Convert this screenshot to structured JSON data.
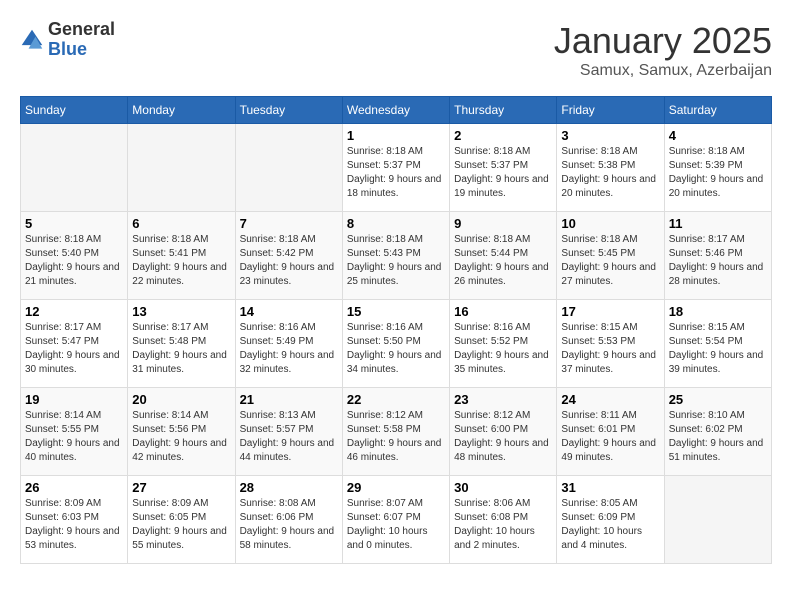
{
  "logo": {
    "general": "General",
    "blue": "Blue"
  },
  "title": "January 2025",
  "location": "Samux, Samux, Azerbaijan",
  "weekdays": [
    "Sunday",
    "Monday",
    "Tuesday",
    "Wednesday",
    "Thursday",
    "Friday",
    "Saturday"
  ],
  "weeks": [
    [
      {
        "day": "",
        "empty": true
      },
      {
        "day": "",
        "empty": true
      },
      {
        "day": "",
        "empty": true
      },
      {
        "day": "1",
        "sunrise": "8:18 AM",
        "sunset": "5:37 PM",
        "daylight": "9 hours and 18 minutes."
      },
      {
        "day": "2",
        "sunrise": "8:18 AM",
        "sunset": "5:37 PM",
        "daylight": "9 hours and 19 minutes."
      },
      {
        "day": "3",
        "sunrise": "8:18 AM",
        "sunset": "5:38 PM",
        "daylight": "9 hours and 20 minutes."
      },
      {
        "day": "4",
        "sunrise": "8:18 AM",
        "sunset": "5:39 PM",
        "daylight": "9 hours and 20 minutes."
      }
    ],
    [
      {
        "day": "5",
        "sunrise": "8:18 AM",
        "sunset": "5:40 PM",
        "daylight": "9 hours and 21 minutes."
      },
      {
        "day": "6",
        "sunrise": "8:18 AM",
        "sunset": "5:41 PM",
        "daylight": "9 hours and 22 minutes."
      },
      {
        "day": "7",
        "sunrise": "8:18 AM",
        "sunset": "5:42 PM",
        "daylight": "9 hours and 23 minutes."
      },
      {
        "day": "8",
        "sunrise": "8:18 AM",
        "sunset": "5:43 PM",
        "daylight": "9 hours and 25 minutes."
      },
      {
        "day": "9",
        "sunrise": "8:18 AM",
        "sunset": "5:44 PM",
        "daylight": "9 hours and 26 minutes."
      },
      {
        "day": "10",
        "sunrise": "8:18 AM",
        "sunset": "5:45 PM",
        "daylight": "9 hours and 27 minutes."
      },
      {
        "day": "11",
        "sunrise": "8:17 AM",
        "sunset": "5:46 PM",
        "daylight": "9 hours and 28 minutes."
      }
    ],
    [
      {
        "day": "12",
        "sunrise": "8:17 AM",
        "sunset": "5:47 PM",
        "daylight": "9 hours and 30 minutes."
      },
      {
        "day": "13",
        "sunrise": "8:17 AM",
        "sunset": "5:48 PM",
        "daylight": "9 hours and 31 minutes."
      },
      {
        "day": "14",
        "sunrise": "8:16 AM",
        "sunset": "5:49 PM",
        "daylight": "9 hours and 32 minutes."
      },
      {
        "day": "15",
        "sunrise": "8:16 AM",
        "sunset": "5:50 PM",
        "daylight": "9 hours and 34 minutes."
      },
      {
        "day": "16",
        "sunrise": "8:16 AM",
        "sunset": "5:52 PM",
        "daylight": "9 hours and 35 minutes."
      },
      {
        "day": "17",
        "sunrise": "8:15 AM",
        "sunset": "5:53 PM",
        "daylight": "9 hours and 37 minutes."
      },
      {
        "day": "18",
        "sunrise": "8:15 AM",
        "sunset": "5:54 PM",
        "daylight": "9 hours and 39 minutes."
      }
    ],
    [
      {
        "day": "19",
        "sunrise": "8:14 AM",
        "sunset": "5:55 PM",
        "daylight": "9 hours and 40 minutes."
      },
      {
        "day": "20",
        "sunrise": "8:14 AM",
        "sunset": "5:56 PM",
        "daylight": "9 hours and 42 minutes."
      },
      {
        "day": "21",
        "sunrise": "8:13 AM",
        "sunset": "5:57 PM",
        "daylight": "9 hours and 44 minutes."
      },
      {
        "day": "22",
        "sunrise": "8:12 AM",
        "sunset": "5:58 PM",
        "daylight": "9 hours and 46 minutes."
      },
      {
        "day": "23",
        "sunrise": "8:12 AM",
        "sunset": "6:00 PM",
        "daylight": "9 hours and 48 minutes."
      },
      {
        "day": "24",
        "sunrise": "8:11 AM",
        "sunset": "6:01 PM",
        "daylight": "9 hours and 49 minutes."
      },
      {
        "day": "25",
        "sunrise": "8:10 AM",
        "sunset": "6:02 PM",
        "daylight": "9 hours and 51 minutes."
      }
    ],
    [
      {
        "day": "26",
        "sunrise": "8:09 AM",
        "sunset": "6:03 PM",
        "daylight": "9 hours and 53 minutes."
      },
      {
        "day": "27",
        "sunrise": "8:09 AM",
        "sunset": "6:05 PM",
        "daylight": "9 hours and 55 minutes."
      },
      {
        "day": "28",
        "sunrise": "8:08 AM",
        "sunset": "6:06 PM",
        "daylight": "9 hours and 58 minutes."
      },
      {
        "day": "29",
        "sunrise": "8:07 AM",
        "sunset": "6:07 PM",
        "daylight": "10 hours and 0 minutes."
      },
      {
        "day": "30",
        "sunrise": "8:06 AM",
        "sunset": "6:08 PM",
        "daylight": "10 hours and 2 minutes."
      },
      {
        "day": "31",
        "sunrise": "8:05 AM",
        "sunset": "6:09 PM",
        "daylight": "10 hours and 4 minutes."
      },
      {
        "day": "",
        "empty": true
      }
    ]
  ]
}
